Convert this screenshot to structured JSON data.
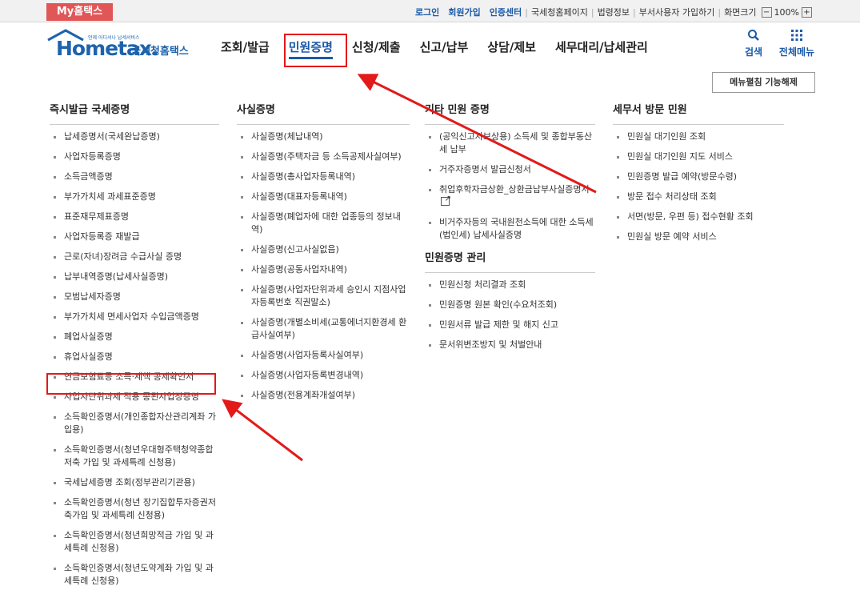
{
  "top": {
    "my_hometax": "My홈택스",
    "links": [
      "로그인",
      "회원가입",
      "인증센터"
    ],
    "plain_links": [
      "국세청홈페이지",
      "법령정보",
      "부서사용자 가입하기",
      "화면크기"
    ],
    "zoom": "100%",
    "zoom_minus": "−",
    "zoom_plus": "+"
  },
  "logo": {
    "tagline": "언제 어디서나 납세서비스",
    "brand": "Hometax.",
    "korean": "국세청홈택스"
  },
  "gnb": [
    "조회/발급",
    "민원증명",
    "신청/제출",
    "신고/납부",
    "상담/제보",
    "세무대리/납세관리"
  ],
  "header_icons": {
    "search": "검색",
    "all_menu": "전체메뉴"
  },
  "menu_fix_button": "메뉴펼침 기능해제",
  "columns": [
    {
      "title": "즉시발급 국세증명",
      "items": [
        "납세증명서(국세완납증명)",
        "사업자등록증명",
        "소득금액증명",
        "부가가치세 과세표준증명",
        "표준재무제표증명",
        "사업자등록증 재발급",
        "근로(자녀)장려금 수급사실 증명",
        "납부내역증명(납세사실증명)",
        "모범납세자증명",
        "부가가치세 면세사업자 수입금액증명",
        "폐업사실증명",
        "휴업사실증명",
        "연금보험료등 소득·세액 공제확인서",
        "사업자단위과세 적용 종된사업장증명",
        "소득확인증명서(개인종합자산관리계좌 가입용)",
        "소득확인증명서(청년우대형주택청약종합저축 가입 및 과세특례 신청용)",
        "국세납세증명 조회(정부관리기관용)",
        "소득확인증명서(청년 장기집합투자증권저축가입 및 과세특례 신청용)",
        "소득확인증명서(청년희망적금 가입 및 과세특례 신청용)",
        "소득확인증명서(청년도약계좌 가입 및 과세특례 신청용)"
      ]
    },
    {
      "title": "사실증명",
      "items": [
        "사실증명(체납내역)",
        "사실증명(주택자금 등 소득공제사실여부)",
        "사실증명(총사업자등록내역)",
        "사실증명(대표자등록내역)",
        "사실증명(폐업자에 대한 업종등의 정보내역)",
        "사실증명(신고사실없음)",
        "사실증명(공동사업자내역)",
        "사실증명(사업자단위과세 승인시 지점사업자등록번호 직권말소)",
        "사실증명(개별소비세(교통에너지환경세 환급사실여부)",
        "사실증명(사업자등록사실여부)",
        "사실증명(사업자등록변경내역)",
        "사실증명(전용계좌개설여부)"
      ]
    },
    {
      "title": "기타 민원 증명",
      "items": [
        "(공익신고자보상용) 소득세 및 종합부동산세 납부",
        "거주자증명서 발급신청서",
        "취업후학자금상환_상환금납부사실증명서",
        "비거주자등의 국내원천소득에 대한 소득세(법인세) 납세사실증명"
      ],
      "sub_title": "민원증명 관리",
      "sub_items": [
        "민원신청 처리결과 조회",
        "민원증명 원본 확인(수요처조회)",
        "민원서류 발급 제한 및 해지 신고",
        "문서위변조방지 및 처벌안내"
      ]
    },
    {
      "title": "세무서 방문 민원",
      "items": [
        "민원실 대기인원 조회",
        "민원실 대기인원 지도 서비스",
        "민원증명 발급 예약(방문수령)",
        "방문 접수 처리상태 조회",
        "서면(방문, 우편 등) 접수현황 조회",
        "민원실 방문 예약 서비스"
      ]
    }
  ],
  "colors": {
    "accent_blue": "#1b5aa7",
    "highlight_red": "#e21a1a",
    "my_hometax_bg": "#e15656"
  }
}
